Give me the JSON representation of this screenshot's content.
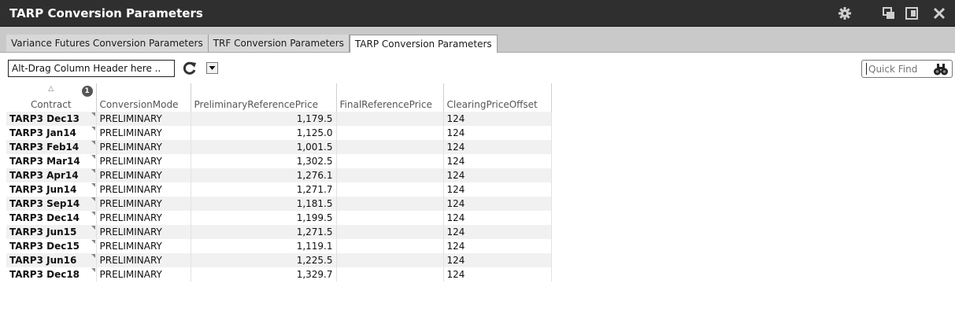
{
  "window": {
    "title": "TARP Conversion Parameters"
  },
  "titlebar_icons": [
    "gear-icon",
    "restore-window-icon",
    "detach-icon",
    "close-icon"
  ],
  "tabs": [
    {
      "label": "Variance Futures Conversion Parameters",
      "active": false
    },
    {
      "label": "TRF Conversion Parameters",
      "active": false
    },
    {
      "label": "TARP Conversion Parameters",
      "active": true
    }
  ],
  "toolbar": {
    "group_by_text": "Alt-Drag Column Header here ..",
    "quick_find_placeholder": "Quick Find"
  },
  "grid": {
    "sort_badge": "1",
    "columns": [
      "Contract",
      "ConversionMode",
      "PreliminaryReferencePrice",
      "FinalReferencePrice",
      "ClearingPriceOffset"
    ],
    "rows": [
      {
        "contract": "TARP3 Dec13",
        "mode": "PRELIMINARY",
        "prelim": "1,179.5",
        "final": "",
        "offset": "124"
      },
      {
        "contract": "TARP3 Jan14",
        "mode": "PRELIMINARY",
        "prelim": "1,125.0",
        "final": "",
        "offset": "124"
      },
      {
        "contract": "TARP3 Feb14",
        "mode": "PRELIMINARY",
        "prelim": "1,001.5",
        "final": "",
        "offset": "124"
      },
      {
        "contract": "TARP3 Mar14",
        "mode": "PRELIMINARY",
        "prelim": "1,302.5",
        "final": "",
        "offset": "124"
      },
      {
        "contract": "TARP3 Apr14",
        "mode": "PRELIMINARY",
        "prelim": "1,276.1",
        "final": "",
        "offset": "124"
      },
      {
        "contract": "TARP3 Jun14",
        "mode": "PRELIMINARY",
        "prelim": "1,271.7",
        "final": "",
        "offset": "124"
      },
      {
        "contract": "TARP3 Sep14",
        "mode": "PRELIMINARY",
        "prelim": "1,181.5",
        "final": "",
        "offset": "124"
      },
      {
        "contract": "TARP3 Dec14",
        "mode": "PRELIMINARY",
        "prelim": "1,199.5",
        "final": "",
        "offset": "124"
      },
      {
        "contract": "TARP3 Jun15",
        "mode": "PRELIMINARY",
        "prelim": "1,271.5",
        "final": "",
        "offset": "124"
      },
      {
        "contract": "TARP3 Dec15",
        "mode": "PRELIMINARY",
        "prelim": "1,119.1",
        "final": "",
        "offset": "124"
      },
      {
        "contract": "TARP3 Jun16",
        "mode": "PRELIMINARY",
        "prelim": "1,225.5",
        "final": "",
        "offset": "124"
      },
      {
        "contract": "TARP3 Dec18",
        "mode": "PRELIMINARY",
        "prelim": "1,329.7",
        "final": "",
        "offset": "124"
      }
    ]
  }
}
